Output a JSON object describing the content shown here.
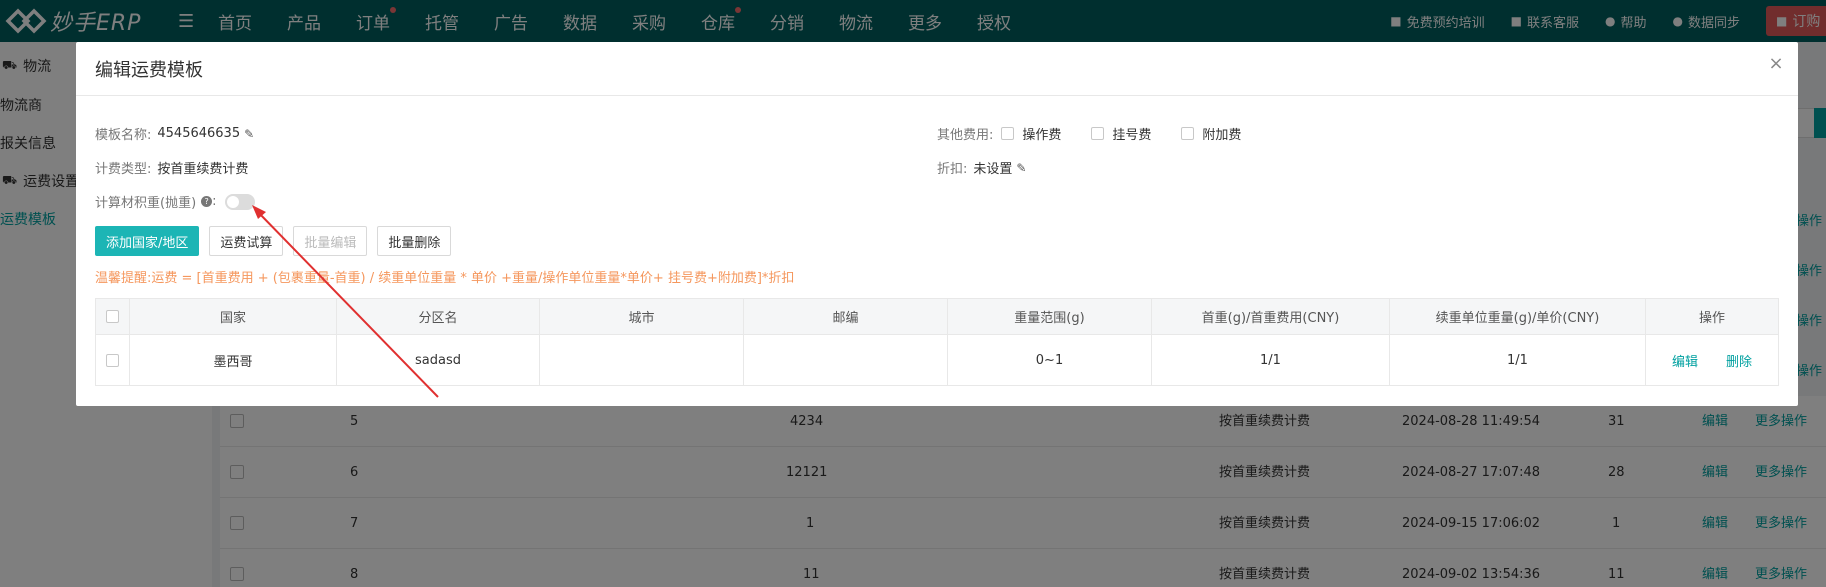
{
  "app": {
    "logo_text": "妙手ERP",
    "nav": [
      "首页",
      "产品",
      "订单",
      "托管",
      "广告",
      "数据",
      "采购",
      "仓库",
      "分销",
      "物流",
      "更多",
      "授权"
    ],
    "nav_badges": [
      "订单",
      "仓库"
    ],
    "right": {
      "training": "免费预约培训",
      "service": "联系客服",
      "help": "帮助",
      "sync": "数据同步",
      "order": "订购"
    }
  },
  "sidebar": {
    "group1": "物流",
    "item1": "物流商",
    "item2": "报关信息",
    "group2": "运费设置",
    "item3": "运费模板"
  },
  "bg_table": {
    "rows": [
      {
        "idx": "5",
        "name": "4234",
        "type": "按首重续费计费",
        "time": "2024-08-28 11:49:54",
        "count": "31",
        "edit": "编辑",
        "more": "更多操作"
      },
      {
        "idx": "6",
        "name": "12121",
        "type": "按首重续费计费",
        "time": "2024-08-27 17:07:48",
        "count": "28",
        "edit": "编辑",
        "more": "更多操作"
      },
      {
        "idx": "7",
        "name": "1",
        "type": "按首重续费计费",
        "time": "2024-09-15 17:06:02",
        "count": "1",
        "edit": "编辑",
        "more": "更多操作"
      },
      {
        "idx": "8",
        "name": "11",
        "type": "按首重续费计费",
        "time": "2024-09-02 13:54:36",
        "count": "11",
        "edit": "编辑",
        "more": "更多操作"
      }
    ],
    "side_links": [
      "操作",
      "操作",
      "操作",
      "操作"
    ]
  },
  "modal": {
    "title": "编辑运费模板",
    "close": "×",
    "template_name_label": "模板名称:",
    "template_name_value": "4545646635",
    "billing_type_label": "计费类型:",
    "billing_type_value": "按首重续费计费",
    "volume_weight_label": "计算材积重(抛重)",
    "volume_weight_colon": ":",
    "volume_weight_enabled": false,
    "other_fees_label": "其他费用:",
    "other_fees": [
      "操作费",
      "挂号费",
      "附加费"
    ],
    "discount_label": "折扣:",
    "discount_value": "未设置",
    "buttons": {
      "add_country": "添加国家/地区",
      "trial_calc": "运费试算",
      "batch_edit": "批量编辑",
      "batch_delete": "批量删除"
    },
    "tip": "温馨提醒:运费 = [首重费用 + (包裹重量-首重) / 续重单位重量 * 单价 +重量/操作单位重量*单价+ 挂号费+附加费]*折扣",
    "table": {
      "headers": [
        "国家",
        "分区名",
        "城市",
        "邮编",
        "重量范围(g)",
        "首重(g)/首重费用(CNY)",
        "续重单位重量(g)/单价(CNY)",
        "操作"
      ],
      "rows": [
        {
          "country": "墨西哥",
          "zone": "sadasd",
          "city": "",
          "zip": "",
          "weight_range": "0~1",
          "first": "1/1",
          "cont": "1/1",
          "edit": "编辑",
          "delete": "删除"
        }
      ]
    }
  },
  "colors": {
    "nav_bg": "#005e5e",
    "accent": "#00a0a0",
    "primary_btn": "#1cb5b5",
    "tip": "#f5975d",
    "arrow": "#e03030"
  }
}
